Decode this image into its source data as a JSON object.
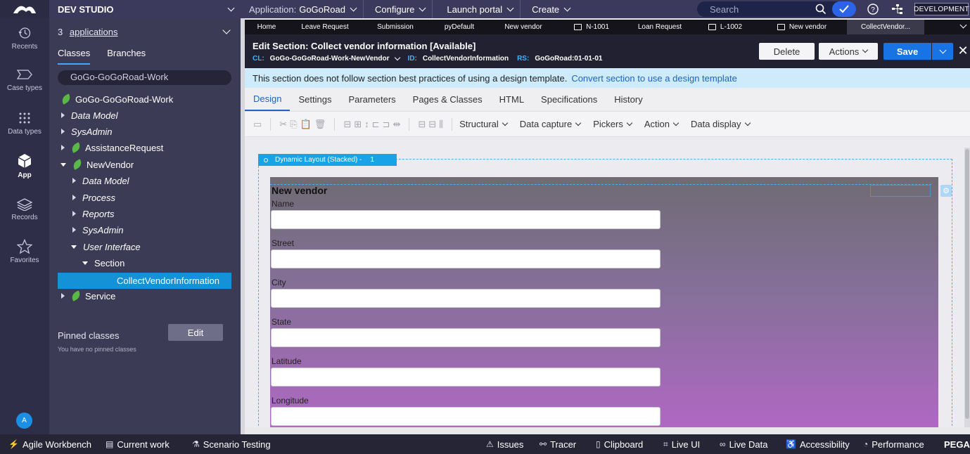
{
  "topbar": {
    "studio": "DEV STUDIO",
    "application_label": "Application:",
    "application_value": "GoGoRoad",
    "configure": "Configure",
    "launch_portal": "Launch portal",
    "create": "Create",
    "search_placeholder": "Search",
    "environment_badge": "DEVELOPMENT"
  },
  "rail": {
    "items": [
      {
        "label": "Recents",
        "icon": "history-icon"
      },
      {
        "label": "Case types",
        "icon": "case-types-icon"
      },
      {
        "label": "Data types",
        "icon": "data-types-icon"
      },
      {
        "label": "App",
        "icon": "app-cube-icon"
      },
      {
        "label": "Records",
        "icon": "records-layers-icon"
      },
      {
        "label": "Favorites",
        "icon": "star-icon"
      }
    ],
    "avatar": "A"
  },
  "explorer": {
    "apps_count": "3",
    "apps_link": "applications",
    "tabs": [
      "Classes",
      "Branches"
    ],
    "class_filter": "GoGo-GoGoRoad-Work",
    "tree": [
      {
        "label": "GoGo-GoGoRoad-Work"
      },
      {
        "label": "Data Model"
      },
      {
        "label": "SysAdmin"
      },
      {
        "label": "AssistanceRequest"
      },
      {
        "label": "NewVendor"
      },
      {
        "label": "Data Model"
      },
      {
        "label": "Process"
      },
      {
        "label": "Reports"
      },
      {
        "label": "SysAdmin"
      },
      {
        "label": "User Interface"
      },
      {
        "label": "Section"
      },
      {
        "label": "CollectVendorInformation"
      },
      {
        "label": "Service"
      }
    ],
    "pinned_title": "Pinned classes",
    "pinned_empty": "You have no pinned classes",
    "edit_button": "Edit"
  },
  "doc_tabs": [
    "Home",
    "Leave Request",
    "Submission",
    "pyDefault",
    "New vendor",
    "N-1001",
    "Loan Request",
    "L-1002",
    "New vendor",
    "CollectVendor..."
  ],
  "header": {
    "title": "Edit  Section: Collect vendor information [Available]",
    "cl_key": "CL:",
    "cl_value": "GoGo-GoGoRoad-Work-NewVendor",
    "id_key": "ID:",
    "id_value": "CollectVendorInformation",
    "rs_key": "RS:",
    "rs_value": "GoGoRoad:01-01-01",
    "delete": "Delete",
    "actions": "Actions",
    "save": "Save"
  },
  "notice": {
    "text": "This section does not follow section best practices of using a design template.",
    "link": "Convert section to use a design template"
  },
  "subtabs": [
    "Design",
    "Settings",
    "Parameters",
    "Pages & Classes",
    "HTML",
    "Specifications",
    "History"
  ],
  "toolbar": {
    "dropdowns": [
      "Structural",
      "Data capture",
      "Pickers",
      "Action",
      "Data display"
    ]
  },
  "canvas": {
    "layout_tag": "Dynamic Layout (Stacked) -",
    "layout_num": "1",
    "section_title": "New vendor",
    "fields": [
      "Name",
      "Street",
      "City",
      "State",
      "Latitude",
      "Longitude"
    ]
  },
  "bottombar": {
    "items": [
      "Agile Workbench",
      "Current work",
      "Scenario Testing",
      "Issues",
      "Tracer",
      "Clipboard",
      "Live UI",
      "Live Data",
      "Accessibility",
      "Performance"
    ],
    "brand": "PEGA"
  }
}
